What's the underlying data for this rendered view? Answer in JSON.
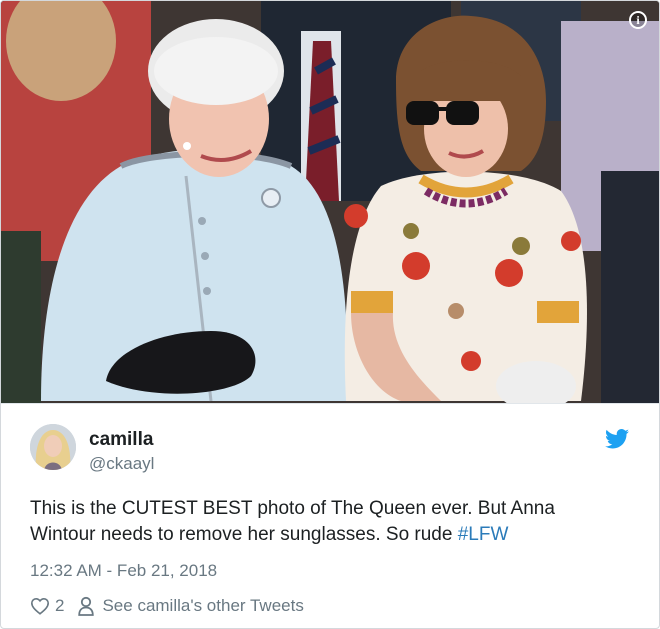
{
  "photo": {
    "info_glyph": "i",
    "icon": "info-icon"
  },
  "tweet": {
    "author_name": "camilla",
    "author_handle": "@ckaayl",
    "text_line1": "This is the CUTEST BEST photo of The Queen ever. But Anna",
    "text_line2_prefix": "Wintour needs to remove her sunglasses. So rude ",
    "hashtag": "#LFW",
    "timestamp": "12:32 AM - Feb 21, 2018",
    "like_count": "2",
    "other_tweets_label": "See camilla's other Tweets",
    "brand_icon": "twitter-bird-icon",
    "colors": {
      "brand": "#1da1f2",
      "link": "#2b7bb9",
      "text": "#1c2022",
      "muted": "#697882"
    }
  }
}
